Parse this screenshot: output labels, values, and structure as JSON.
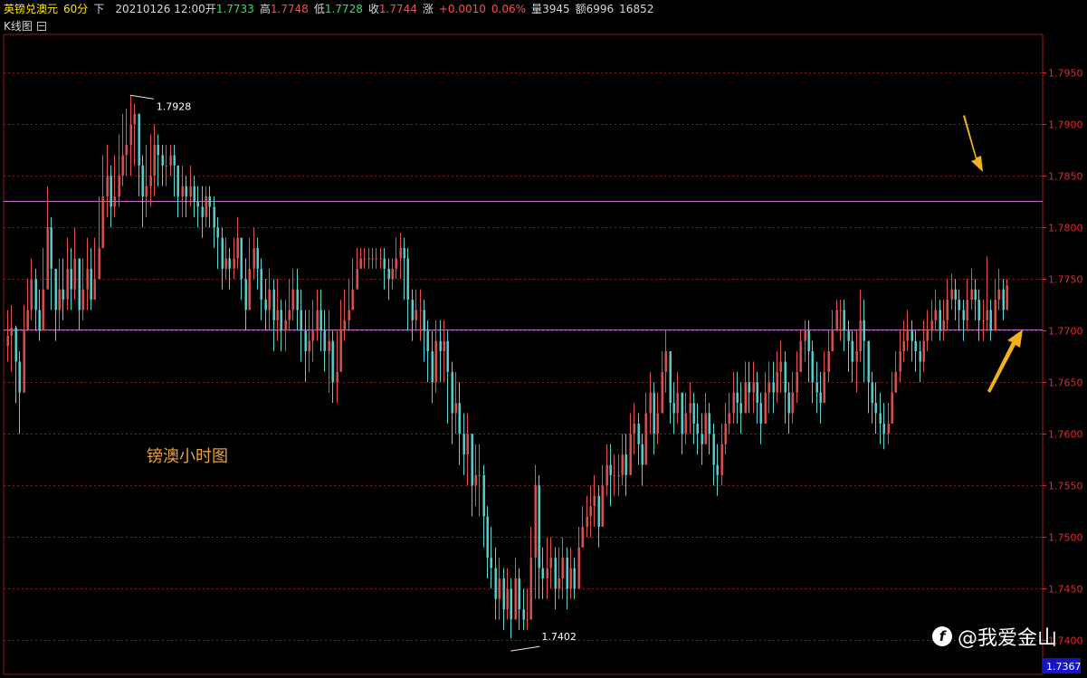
{
  "header": {
    "symbol": "英镑兑澳元",
    "period": "60分",
    "direction": "下",
    "datetime": "20210126 12:00",
    "open_label": "开",
    "open_value": "1.7733",
    "high_label": "高",
    "high_value": "1.7748",
    "low_label": "低",
    "low_value": "1.7728",
    "close_label": "收",
    "close_value": "1.7744",
    "change_label": "涨",
    "change_value": "+0.0010",
    "change_pct": "0.06%",
    "volume_label": "量",
    "volume_value": "3945",
    "amount_label": "额",
    "amount_value": "6996",
    "extra_value": "16852"
  },
  "subheader": {
    "chart_label": "K线图"
  },
  "annotations": {
    "chart_title": "镑澳小时图",
    "high_marker": "1.7928",
    "low_marker": "1.7402",
    "current_price": "1.7367"
  },
  "watermark": {
    "logo_glyph": "f",
    "text": "@我爱金山"
  },
  "colors": {
    "background": "#000000",
    "up_candle": "#e0524f",
    "down_candle": "#57d3d3",
    "gridline": "#8b1c1c",
    "level_line": "#c46ac8",
    "arrow": "#f2b21c",
    "axis_text": "#e0292c",
    "title_text": "#e8a13b",
    "header_yellow": "#ffe600",
    "header_green": "#27e85a",
    "header_red": "#ff4b4b",
    "header_white": "#d8d8d8",
    "header_cyan": "#54e4e4",
    "price_tag_bg": "#1414c8"
  },
  "chart_data": {
    "type": "candlestick",
    "title": "",
    "xlabel": "",
    "ylabel": "",
    "ylim": [
      1.7367,
      1.7987
    ],
    "yticks": [
      "1.7950",
      "1.7900",
      "1.7850",
      "1.7800",
      "1.7750",
      "1.7700",
      "1.7650",
      "1.7600",
      "1.7550",
      "1.7500",
      "1.7450",
      "1.7400"
    ],
    "horizontal_levels": [
      1.7826,
      1.7701
    ],
    "close": [
      1.7695,
      1.7703,
      1.767,
      1.764,
      1.77,
      1.772,
      1.775,
      1.772,
      1.77,
      1.774,
      1.78,
      1.776,
      1.772,
      1.774,
      1.773,
      1.776,
      1.774,
      1.777,
      1.772,
      1.774,
      1.776,
      1.773,
      1.775,
      1.778,
      1.783,
      1.785,
      1.782,
      1.783,
      1.785,
      1.787,
      1.788,
      1.79,
      1.791,
      1.786,
      1.783,
      1.784,
      1.785,
      1.788,
      1.787,
      1.786,
      1.786,
      1.787,
      1.786,
      1.783,
      1.784,
      1.783,
      1.784,
      1.7825,
      1.782,
      1.781,
      1.783,
      1.782,
      1.78,
      1.779,
      1.776,
      1.777,
      1.776,
      1.777,
      1.779,
      1.775,
      1.772,
      1.776,
      1.778,
      1.776,
      1.773,
      1.772,
      1.774,
      1.771,
      1.772,
      1.77,
      1.771,
      1.772,
      1.774,
      1.772,
      1.77,
      1.768,
      1.769,
      1.77,
      1.772,
      1.77,
      1.768,
      1.769,
      1.765,
      1.766,
      1.77,
      1.771,
      1.772,
      1.774,
      1.776,
      1.777,
      1.777,
      1.777,
      1.777,
      1.777,
      1.777,
      1.776,
      1.775,
      1.776,
      1.777,
      1.778,
      1.777,
      1.773,
      1.771,
      1.772,
      1.772,
      1.77,
      1.768,
      1.765,
      1.769,
      1.768,
      1.769,
      1.766,
      1.762,
      1.763,
      1.76,
      1.758,
      1.76,
      1.755,
      1.756,
      1.756,
      1.752,
      1.748,
      1.747,
      1.744,
      1.746,
      1.743,
      1.745,
      1.742,
      1.746,
      1.743,
      1.742,
      1.742,
      1.748,
      1.755,
      1.747,
      1.746,
      1.747,
      1.748,
      1.745,
      1.746,
      1.748,
      1.745,
      1.747,
      1.745,
      1.749,
      1.751,
      1.752,
      1.753,
      1.754,
      1.751,
      1.755,
      1.757,
      1.756,
      1.756,
      1.756,
      1.758,
      1.756,
      1.76,
      1.761,
      1.759,
      1.757,
      1.762,
      1.764,
      1.76,
      1.762,
      1.766,
      1.768,
      1.763,
      1.762,
      1.764,
      1.76,
      1.762,
      1.763,
      1.761,
      1.76,
      1.759,
      1.762,
      1.76,
      1.757,
      1.756,
      1.759,
      1.761,
      1.762,
      1.764,
      1.763,
      1.762,
      1.765,
      1.764,
      1.765,
      1.763,
      1.761,
      1.764,
      1.765,
      1.764,
      1.766,
      1.767,
      1.764,
      1.762,
      1.764,
      1.766,
      1.769,
      1.77,
      1.768,
      1.765,
      1.764,
      1.763,
      1.766,
      1.768,
      1.77,
      1.772,
      1.772,
      1.77,
      1.769,
      1.767,
      1.768,
      1.771,
      1.769,
      1.765,
      1.763,
      1.762,
      1.761,
      1.76,
      1.761,
      1.764,
      1.766,
      1.768,
      1.769,
      1.77,
      1.769,
      1.768,
      1.767,
      1.769,
      1.77,
      1.771,
      1.772,
      1.77,
      1.771,
      1.773,
      1.774,
      1.773,
      1.772,
      1.771,
      1.773,
      1.774,
      1.773,
      1.771,
      1.771,
      1.772,
      1.77,
      1.773,
      1.774,
      1.772,
      1.7744
    ],
    "high": [
      1.772,
      1.7725,
      1.7705,
      1.768,
      1.7725,
      1.775,
      1.777,
      1.776,
      1.774,
      1.778,
      1.784,
      1.781,
      1.776,
      1.777,
      1.777,
      1.779,
      1.778,
      1.78,
      1.777,
      1.777,
      1.779,
      1.778,
      1.779,
      1.783,
      1.787,
      1.788,
      1.786,
      1.787,
      1.789,
      1.791,
      1.7915,
      1.7928,
      1.792,
      1.79,
      1.787,
      1.788,
      1.789,
      1.79,
      1.789,
      1.788,
      1.788,
      1.788,
      1.788,
      1.786,
      1.786,
      1.785,
      1.786,
      1.785,
      1.784,
      1.784,
      1.784,
      1.784,
      1.783,
      1.781,
      1.78,
      1.779,
      1.778,
      1.779,
      1.781,
      1.779,
      1.777,
      1.779,
      1.78,
      1.779,
      1.777,
      1.775,
      1.776,
      1.775,
      1.775,
      1.773,
      1.773,
      1.775,
      1.776,
      1.776,
      1.774,
      1.772,
      1.772,
      1.773,
      1.774,
      1.774,
      1.772,
      1.772,
      1.77,
      1.77,
      1.773,
      1.774,
      1.775,
      1.777,
      1.778,
      1.778,
      1.778,
      1.778,
      1.778,
      1.778,
      1.778,
      1.778,
      1.777,
      1.777,
      1.779,
      1.7795,
      1.779,
      1.778,
      1.774,
      1.774,
      1.774,
      1.773,
      1.771,
      1.77,
      1.771,
      1.771,
      1.771,
      1.77,
      1.767,
      1.766,
      1.765,
      1.762,
      1.762,
      1.76,
      1.759,
      1.759,
      1.757,
      1.753,
      1.751,
      1.749,
      1.748,
      1.747,
      1.747,
      1.746,
      1.748,
      1.747,
      1.745,
      1.745,
      1.751,
      1.757,
      1.756,
      1.749,
      1.75,
      1.75,
      1.749,
      1.749,
      1.75,
      1.749,
      1.749,
      1.748,
      1.751,
      1.753,
      1.754,
      1.755,
      1.756,
      1.755,
      1.757,
      1.759,
      1.759,
      1.758,
      1.758,
      1.76,
      1.76,
      1.762,
      1.763,
      1.762,
      1.76,
      1.764,
      1.766,
      1.765,
      1.764,
      1.768,
      1.77,
      1.768,
      1.765,
      1.766,
      1.764,
      1.764,
      1.765,
      1.764,
      1.763,
      1.762,
      1.764,
      1.763,
      1.761,
      1.759,
      1.761,
      1.763,
      1.764,
      1.766,
      1.766,
      1.765,
      1.767,
      1.767,
      1.767,
      1.766,
      1.764,
      1.766,
      1.767,
      1.767,
      1.768,
      1.769,
      1.768,
      1.765,
      1.766,
      1.768,
      1.77,
      1.771,
      1.771,
      1.769,
      1.767,
      1.766,
      1.768,
      1.77,
      1.772,
      1.773,
      1.773,
      1.773,
      1.771,
      1.77,
      1.77,
      1.774,
      1.773,
      1.769,
      1.766,
      1.765,
      1.764,
      1.763,
      1.763,
      1.766,
      1.768,
      1.77,
      1.771,
      1.772,
      1.771,
      1.77,
      1.769,
      1.771,
      1.772,
      1.773,
      1.774,
      1.773,
      1.773,
      1.775,
      1.7755,
      1.775,
      1.774,
      1.773,
      1.775,
      1.776,
      1.775,
      1.774,
      1.773,
      1.7772,
      1.773,
      1.775,
      1.776,
      1.775,
      1.775
    ],
    "low": [
      1.767,
      1.766,
      1.763,
      1.76,
      1.766,
      1.77,
      1.771,
      1.77,
      1.769,
      1.77,
      1.775,
      1.772,
      1.769,
      1.77,
      1.771,
      1.772,
      1.772,
      1.773,
      1.77,
      1.771,
      1.772,
      1.772,
      1.773,
      1.776,
      1.779,
      1.781,
      1.78,
      1.781,
      1.782,
      1.784,
      1.785,
      1.785,
      1.786,
      1.783,
      1.78,
      1.781,
      1.782,
      1.783,
      1.784,
      1.784,
      1.784,
      1.785,
      1.783,
      1.781,
      1.781,
      1.781,
      1.782,
      1.781,
      1.78,
      1.779,
      1.78,
      1.78,
      1.778,
      1.776,
      1.774,
      1.775,
      1.774,
      1.775,
      1.776,
      1.773,
      1.77,
      1.773,
      1.775,
      1.774,
      1.771,
      1.77,
      1.77,
      1.768,
      1.769,
      1.768,
      1.768,
      1.77,
      1.771,
      1.77,
      1.767,
      1.765,
      1.766,
      1.767,
      1.769,
      1.768,
      1.766,
      1.764,
      1.763,
      1.763,
      1.766,
      1.769,
      1.77,
      1.772,
      1.774,
      1.776,
      1.776,
      1.776,
      1.776,
      1.776,
      1.776,
      1.774,
      1.773,
      1.774,
      1.775,
      1.775,
      1.773,
      1.77,
      1.769,
      1.77,
      1.769,
      1.767,
      1.765,
      1.763,
      1.764,
      1.765,
      1.765,
      1.761,
      1.759,
      1.76,
      1.757,
      1.756,
      1.755,
      1.752,
      1.753,
      1.752,
      1.749,
      1.746,
      1.745,
      1.742,
      1.742,
      1.741,
      1.742,
      1.7402,
      1.742,
      1.741,
      1.741,
      1.741,
      1.744,
      1.744,
      1.744,
      1.744,
      1.744,
      1.745,
      1.743,
      1.744,
      1.744,
      1.743,
      1.744,
      1.744,
      1.746,
      1.749,
      1.75,
      1.75,
      1.751,
      1.749,
      1.752,
      1.754,
      1.753,
      1.754,
      1.754,
      1.755,
      1.754,
      1.757,
      1.758,
      1.757,
      1.755,
      1.758,
      1.76,
      1.758,
      1.759,
      1.762,
      1.764,
      1.761,
      1.76,
      1.761,
      1.758,
      1.759,
      1.76,
      1.759,
      1.758,
      1.757,
      1.759,
      1.758,
      1.755,
      1.754,
      1.755,
      1.758,
      1.76,
      1.761,
      1.761,
      1.76,
      1.762,
      1.762,
      1.762,
      1.761,
      1.759,
      1.761,
      1.762,
      1.762,
      1.763,
      1.764,
      1.761,
      1.76,
      1.761,
      1.763,
      1.766,
      1.767,
      1.765,
      1.763,
      1.762,
      1.761,
      1.763,
      1.765,
      1.768,
      1.77,
      1.769,
      1.768,
      1.766,
      1.765,
      1.764,
      1.767,
      1.765,
      1.762,
      1.761,
      1.76,
      1.759,
      1.7585,
      1.759,
      1.761,
      1.764,
      1.765,
      1.767,
      1.768,
      1.767,
      1.766,
      1.765,
      1.766,
      1.768,
      1.769,
      1.77,
      1.769,
      1.769,
      1.77,
      1.772,
      1.771,
      1.77,
      1.769,
      1.77,
      1.772,
      1.771,
      1.769,
      1.769,
      1.77,
      1.769,
      1.77,
      1.772,
      1.771,
      1.7728
    ]
  }
}
